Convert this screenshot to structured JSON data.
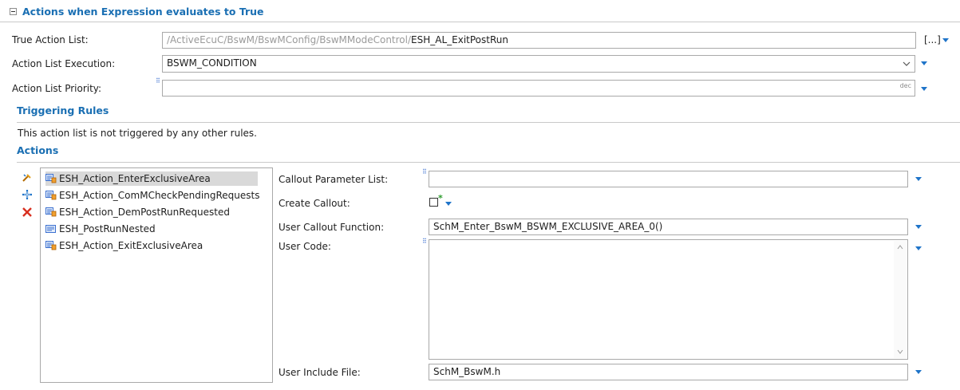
{
  "header": {
    "title": "Actions when Expression evaluates to True"
  },
  "fields": {
    "true_action_list": {
      "label": "True Action List:",
      "path_prefix": "/ActiveEcuC/BswM/BswMConfig/BswMModeControl/",
      "value": "ESH_AL_ExitPostRun",
      "browse_label": "[...]"
    },
    "action_list_execution": {
      "label": "Action List Execution:",
      "value": "BSWM_CONDITION"
    },
    "action_list_priority": {
      "label": "Action List Priority:",
      "value": "",
      "unit": "dec"
    }
  },
  "triggering_rules": {
    "title": "Triggering Rules",
    "message": "This action list is not triggered by any other rules."
  },
  "actions": {
    "title": "Actions",
    "items": [
      {
        "label": "ESH_Action_EnterExclusiveArea",
        "icon": "action-icon",
        "selected": true
      },
      {
        "label": "ESH_Action_ComMCheckPendingRequests",
        "icon": "action-icon",
        "selected": false
      },
      {
        "label": "ESH_Action_DemPostRunRequested",
        "icon": "action-icon",
        "selected": false
      },
      {
        "label": "ESH_PostRunNested",
        "icon": "nested-list-icon",
        "selected": false
      },
      {
        "label": "ESH_Action_ExitExclusiveArea",
        "icon": "action-icon",
        "selected": false
      }
    ]
  },
  "details": {
    "callout_parameter_list": {
      "label": "Callout Parameter List:",
      "value": ""
    },
    "create_callout": {
      "label": "Create Callout:",
      "checked": false,
      "marker": "*"
    },
    "user_callout_function": {
      "label": "User Callout Function:",
      "value": "SchM_Enter_BswM_BSWM_EXCLUSIVE_AREA_0()"
    },
    "user_code": {
      "label": "User Code:",
      "value": ""
    },
    "user_include_file": {
      "label": "User Include File:",
      "value": "SchM_BswM.h"
    }
  },
  "colors": {
    "accent": "#1a6fb3",
    "dropdown": "#1f74c9",
    "selection": "#d9d9d9"
  }
}
